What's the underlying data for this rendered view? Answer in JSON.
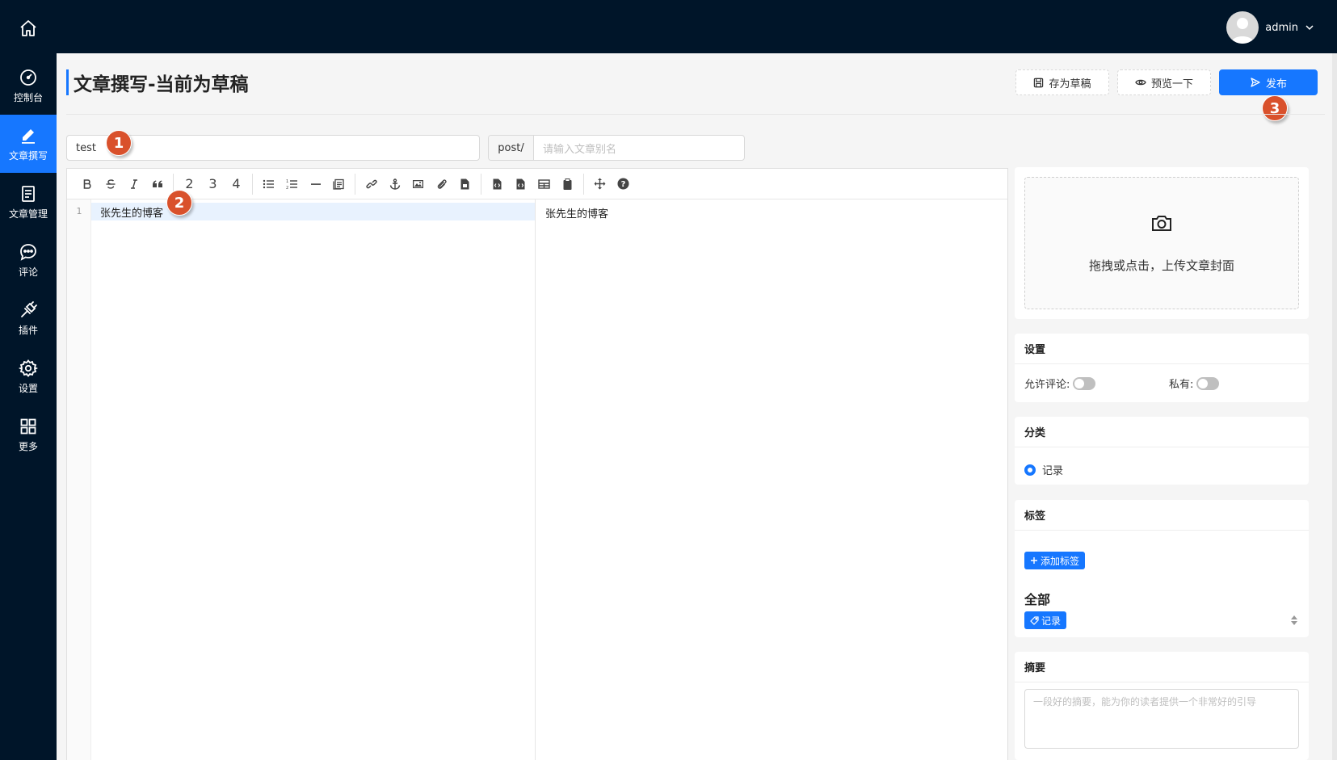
{
  "sidebar": {
    "items": [
      {
        "label": "控制台",
        "icon": "dashboard-icon"
      },
      {
        "label": "文章撰写",
        "icon": "edit-icon",
        "active": true
      },
      {
        "label": "文章管理",
        "icon": "article-icon"
      },
      {
        "label": "评论",
        "icon": "comment-icon"
      },
      {
        "label": "插件",
        "icon": "plugin-icon"
      },
      {
        "label": "设置",
        "icon": "gear-icon"
      },
      {
        "label": "更多",
        "icon": "grid-icon"
      }
    ]
  },
  "header": {
    "username": "admin"
  },
  "page": {
    "title": "文章撰写-当前为草稿"
  },
  "actions": {
    "save_draft": "存为草稿",
    "preview": "预览一下",
    "publish": "发布"
  },
  "badges": {
    "one": "1",
    "two": "2",
    "three": "3"
  },
  "form": {
    "title_value": "test",
    "slug_prefix": "post/",
    "slug_placeholder": "请输入文章别名"
  },
  "editor": {
    "toolbar": {
      "h2": "2",
      "h3": "3",
      "h4": "4"
    },
    "line_number": "1",
    "content": "张先生的博客",
    "preview_content": "张先生的博客"
  },
  "cover": {
    "upload_text": "拖拽或点击，上传文章封面"
  },
  "settings": {
    "title": "设置",
    "allow_comment": "允许评论:",
    "private": "私有:"
  },
  "category": {
    "title": "分类",
    "option": "记录"
  },
  "tags": {
    "title": "标签",
    "add_button": "添加标签",
    "all_label": "全部",
    "tag": "记录"
  },
  "summary": {
    "title": "摘要",
    "placeholder": "一段好的摘要，能为你的读者提供一个非常好的引导"
  },
  "colors": {
    "sidebar_bg": "#001529",
    "accent": "#1677ff",
    "badge": "#d9512c"
  }
}
